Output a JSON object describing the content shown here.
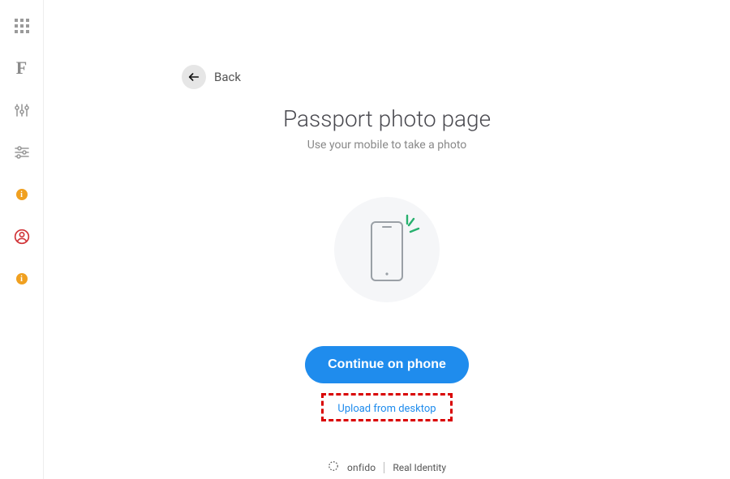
{
  "sidebar": {
    "items": [
      {
        "name": "apps-icon"
      },
      {
        "name": "f-icon"
      },
      {
        "name": "sliders-icon"
      },
      {
        "name": "equalizer-icon"
      },
      {
        "name": "info-icon-1"
      },
      {
        "name": "profile-icon",
        "selected": true
      },
      {
        "name": "info-icon-2"
      }
    ]
  },
  "back": {
    "label": "Back"
  },
  "page": {
    "title": "Passport photo page",
    "subtitle": "Use your mobile to take a photo"
  },
  "actions": {
    "primary": "Continue on phone",
    "secondary": "Upload from desktop"
  },
  "footer": {
    "brand": "onfido",
    "tagline": "Real Identity"
  }
}
